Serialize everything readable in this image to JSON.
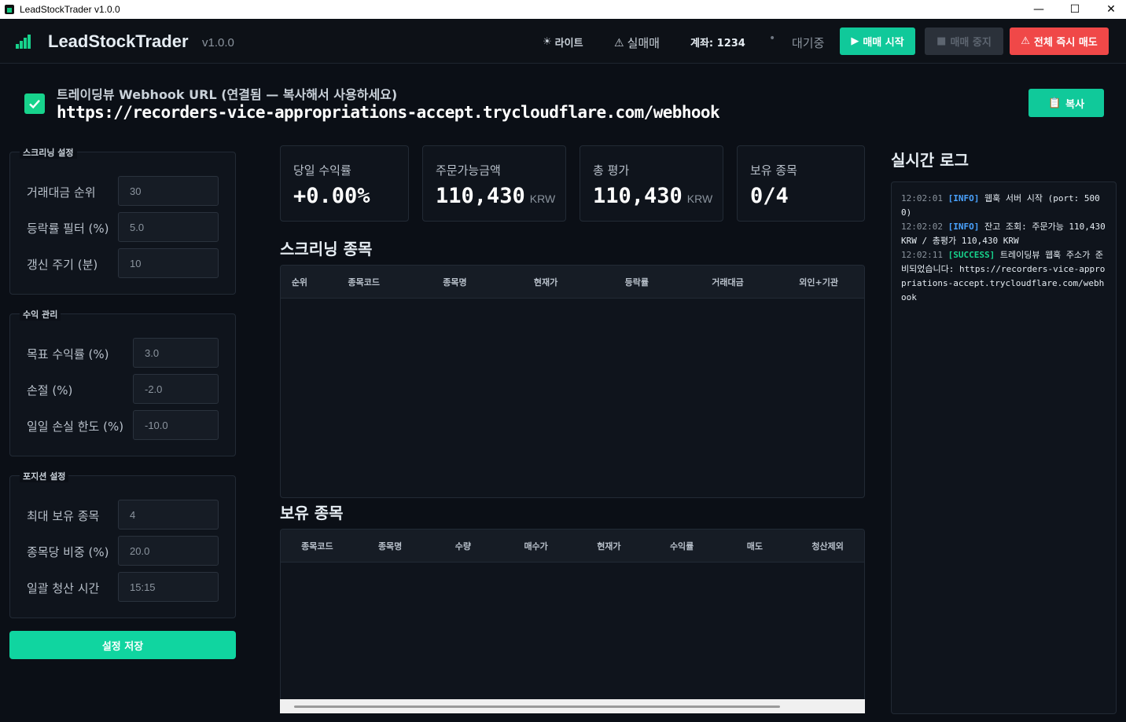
{
  "window": {
    "title": "LeadStockTrader v1.0.0",
    "controls": {
      "minimize": "—",
      "maximize": "☐",
      "close": "✕"
    }
  },
  "header": {
    "app_name": "LeadStockTrader",
    "version": "v1.0.0",
    "theme_toggle": "라이트",
    "mode": "실매매",
    "account": "계좌: 1234",
    "status": "대기중",
    "start_button": "매매 시작",
    "stop_button": "매매 중지",
    "sell_all_button": "전체 즉시 매도"
  },
  "webhook": {
    "label": "트레이딩뷰 Webhook URL (연결됨 — 복사해서 사용하세요)",
    "url": "https://recorders-vice-appropriations-accept.trycloudflare.com/webhook",
    "copy_button": "복사"
  },
  "settings": {
    "screening": {
      "title": "스크리닝 설정",
      "rows": [
        {
          "label": "거래대금 순위",
          "value": "30"
        },
        {
          "label": "등락률 필터 (%)",
          "value": "5.0"
        },
        {
          "label": "갱신 주기 (분)",
          "value": "10"
        }
      ]
    },
    "profit": {
      "title": "수익 관리",
      "rows": [
        {
          "label": "목표 수익률 (%)",
          "value": "3.0"
        },
        {
          "label": "손절 (%)",
          "value": "-2.0"
        },
        {
          "label": "일일 손실 한도 (%)",
          "value": "-10.0"
        }
      ]
    },
    "position": {
      "title": "포지션 설정",
      "rows": [
        {
          "label": "최대 보유 종목",
          "value": "4"
        },
        {
          "label": "종목당 비중 (%)",
          "value": "20.0"
        },
        {
          "label": "일괄 청산 시간",
          "value": "15:15"
        }
      ]
    },
    "save_button": "설정 저장"
  },
  "stats": [
    {
      "title": "당일 수익률",
      "value": "+0.00%",
      "unit": ""
    },
    {
      "title": "주문가능금액",
      "value": "110,430",
      "unit": "KRW"
    },
    {
      "title": "총 평가",
      "value": "110,430",
      "unit": "KRW"
    },
    {
      "title": "보유 종목",
      "value": "0/4",
      "unit": ""
    }
  ],
  "screening_table": {
    "title": "스크리닝 종목",
    "columns": [
      "순위",
      "종목코드",
      "종목명",
      "현재가",
      "등락률",
      "거래대금",
      "외인+기관"
    ]
  },
  "holdings_table": {
    "title": "보유 종목",
    "columns": [
      "종목코드",
      "종목명",
      "수량",
      "매수가",
      "현재가",
      "수익률",
      "매도",
      "청산제외"
    ]
  },
  "log": {
    "title": "실시간 로그",
    "entries": [
      {
        "time": "12:02:01",
        "level": "[INFO]",
        "message": "웹훅 서버 시작 (port: 5000)"
      },
      {
        "time": "12:02:02",
        "level": "[INFO]",
        "message": "잔고 조회: 주문가능 110,430 KRW / 총평가 110,430 KRW"
      },
      {
        "time": "12:02:11",
        "level": "[SUCCESS]",
        "message": "트레이딩뷰 웹훅 주소가 준비되었습니다: https://recorders-vice-appropriations-accept.trycloudflare.com/webhook"
      }
    ]
  },
  "colors": {
    "accent": "#17d38c",
    "start": "#10c99a",
    "danger": "#f04848",
    "info": "#4aa3ff"
  }
}
